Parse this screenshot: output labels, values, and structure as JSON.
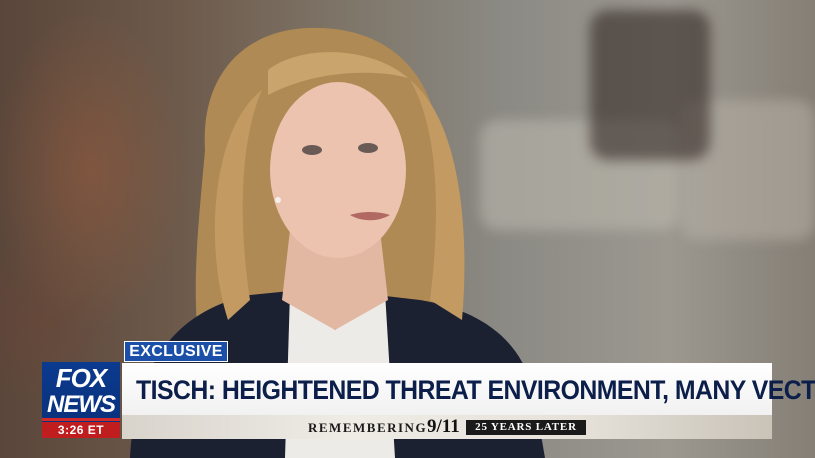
{
  "lower_third": {
    "tag": "EXCLUSIVE",
    "headline": "TISCH: HEIGHTENED THREAT ENVIRONMENT, MANY VECTORS",
    "ticker": {
      "remembering": "REMEMBERING",
      "date": "9/11",
      "years_later": "25 YEARS LATER"
    }
  },
  "network_logo": {
    "line1": "FOX",
    "line2": "NEWS",
    "time": "3:26 ET"
  },
  "colors": {
    "tag_blue": "#1b4fa8",
    "headline_navy": "#0c1e4a",
    "logo_blue": "#0b3a8f",
    "accent_red": "#c01e1e"
  }
}
